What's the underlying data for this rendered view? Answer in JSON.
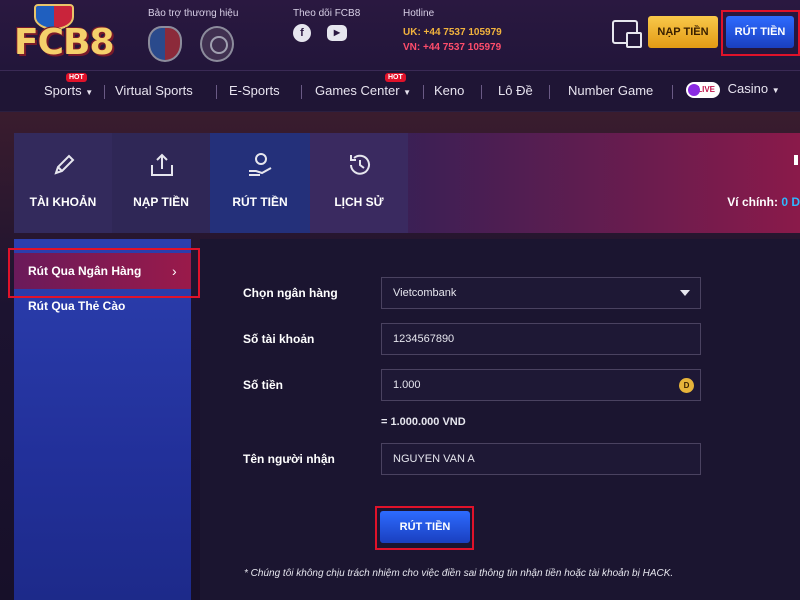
{
  "header": {
    "logo_text": "FCB8",
    "sponsor_label": "Bảo trợ thương hiệu",
    "follow_label": "Theo dõi FCB8",
    "hotline_label": "Hotline",
    "hotline_uk": "UK: +44 7537 105979",
    "hotline_vn": "VN: +44 7537 105979",
    "deposit_button": "NẠP TIỀN",
    "withdraw_button": "RÚT TIỀN"
  },
  "nav": {
    "items": [
      {
        "label": "Sports",
        "hot": true,
        "dropdown": true
      },
      {
        "label": "Virtual Sports"
      },
      {
        "label": "E-Sports"
      },
      {
        "label": "Games Center",
        "hot": true,
        "dropdown": true
      },
      {
        "label": "Keno"
      },
      {
        "label": "Lô Đề"
      },
      {
        "label": "Number Game"
      },
      {
        "label": "Casino",
        "live": true,
        "dropdown": true
      }
    ],
    "hot_badge": "HOT",
    "live_badge": "LIVE"
  },
  "tabs": [
    {
      "label": "TÀI KHOẢN",
      "icon": "pencil-icon"
    },
    {
      "label": "NẠP TIỀN",
      "icon": "upload-tray-icon"
    },
    {
      "label": "RÚT TIỀN",
      "icon": "hand-coin-icon",
      "active": true
    },
    {
      "label": "LỊCH SỬ",
      "icon": "history-clock-icon"
    }
  ],
  "wallet": {
    "label": "Ví chính:",
    "amount": "0 D"
  },
  "sidebar": {
    "items": [
      {
        "label": "Rút Qua Ngân Hàng",
        "active": true
      },
      {
        "label": "Rút Qua Thẻ Cào"
      }
    ]
  },
  "form": {
    "bank_label": "Chọn ngân hàng",
    "bank_value": "Vietcombank",
    "account_label": "Số tài khoản",
    "account_value": "1234567890",
    "amount_label": "Số tiền",
    "amount_value": "1.000",
    "amount_coin": "D",
    "amount_equiv": "= 1.000.000 VND",
    "recipient_label": "Tên người nhận",
    "recipient_value": "NGUYEN VAN A",
    "submit_label": "RÚT TIỀN",
    "disclaimer": "* Chúng tôi không chịu trách nhiệm cho việc điền sai thông tin nhận tiền hoặc tài khoản bị HACK."
  },
  "colors": {
    "highlight": "#e0122a",
    "primary_blue": "#2d6bff",
    "deposit_gold": "#f8c84a",
    "hotline_uk": "#f2b33d",
    "hotline_vn": "#ff4d6b",
    "wallet_amount": "#2fb8ff"
  }
}
